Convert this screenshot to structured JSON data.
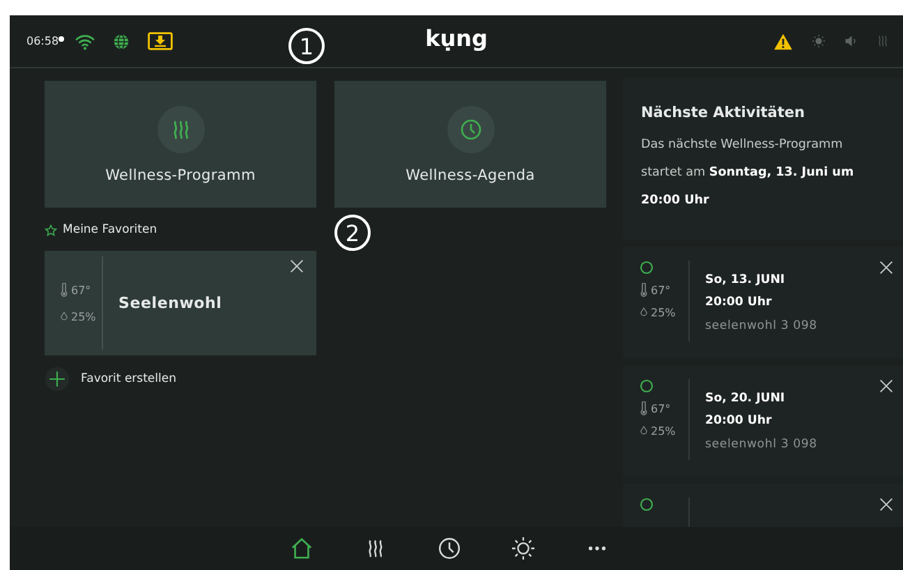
{
  "status_bar": {
    "time": "06:58",
    "logo": "kụng",
    "left_icons": [
      {
        "kind": "wifi",
        "color": "#3fae4f"
      },
      {
        "kind": "globe",
        "color": "#3fae4f"
      },
      {
        "kind": "download",
        "color": "#f2c200"
      }
    ],
    "right_icons": [
      {
        "kind": "warning",
        "color": "#f2c200"
      },
      {
        "kind": "sun",
        "color": "#5d6462"
      },
      {
        "kind": "speaker",
        "color": "#5d6462"
      },
      {
        "kind": "steam",
        "color": "#4a504f"
      }
    ]
  },
  "tiles": [
    {
      "kind": "steam",
      "label": "Wellness-Programm"
    },
    {
      "kind": "clock",
      "label": "Wellness-Agenda"
    }
  ],
  "favorites": {
    "title": "Meine Favoriten",
    "items": [
      {
        "temperature": "67°",
        "humidity": "25%",
        "name": "Seelenwohl"
      }
    ],
    "create_label": "Favorit erstellen"
  },
  "activities": {
    "title": "Nächste Aktivitäten",
    "description": "Das nächste Wellness-Programm startet am **Sonntag, 13. Juni um 20:00 Uhr**",
    "items": [
      {
        "kind": "full",
        "temperature": "67°",
        "humidity": "25%",
        "date": "So, 13. JUNI",
        "time": "20:00 Uhr",
        "program": "seelenwohl 3 098"
      },
      {
        "kind": "full",
        "temperature": "67°",
        "humidity": "25%",
        "date": "So, 20. JUNI",
        "time": "20:00 Uhr",
        "program": "seelenwohl 3 098"
      },
      {
        "kind": "partial"
      }
    ]
  },
  "nav": [
    {
      "kind": "home",
      "selected": true
    },
    {
      "kind": "steam",
      "selected": false
    },
    {
      "kind": "clock",
      "selected": false
    },
    {
      "kind": "sun",
      "selected": false
    },
    {
      "kind": "more",
      "selected": false
    }
  ],
  "annotations": [
    "1",
    "2"
  ]
}
